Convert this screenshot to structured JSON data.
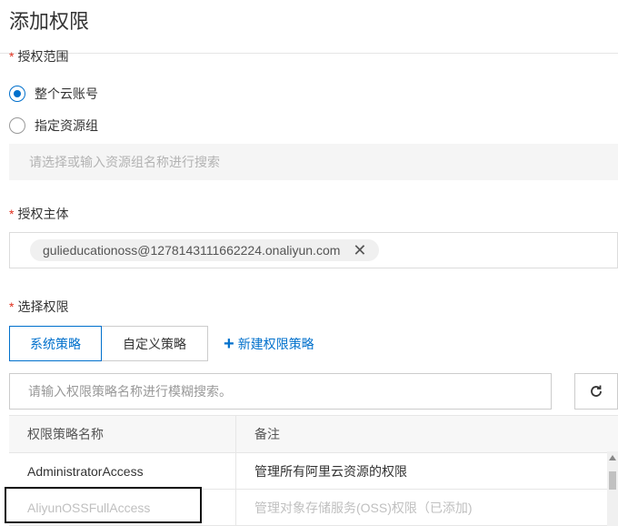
{
  "title": "添加权限",
  "scope": {
    "label": "授权范围",
    "options": [
      {
        "label": "整个云账号",
        "checked": true
      },
      {
        "label": "指定资源组",
        "checked": false
      }
    ],
    "resource_group_placeholder": "请选择或输入资源组名称进行搜索"
  },
  "principal": {
    "label": "授权主体",
    "tag": "gulieducationoss@1278143111662224.onaliyun.com",
    "remove_icon": "close-icon"
  },
  "permissions": {
    "label": "选择权限",
    "tabs": [
      {
        "label": "系统策略",
        "active": true
      },
      {
        "label": "自定义策略",
        "active": false
      }
    ],
    "new_policy_label": "新建权限策略",
    "search_placeholder": "请输入权限策略名称进行模糊搜索。",
    "refresh_icon": "refresh-icon",
    "table": {
      "headers": [
        "权限策略名称",
        "备注"
      ],
      "rows": [
        {
          "name": "AdministratorAccess",
          "note": "管理所有阿里云资源的权限",
          "disabled": false
        },
        {
          "name": "AliyunOSSFullAccess",
          "note": "管理对象存储服务(OSS)权限（已添加)",
          "disabled": true
        }
      ]
    }
  },
  "colors": {
    "accent": "#0070cc",
    "required": "#e0301e",
    "disabled_text": "#c0c0c0"
  }
}
